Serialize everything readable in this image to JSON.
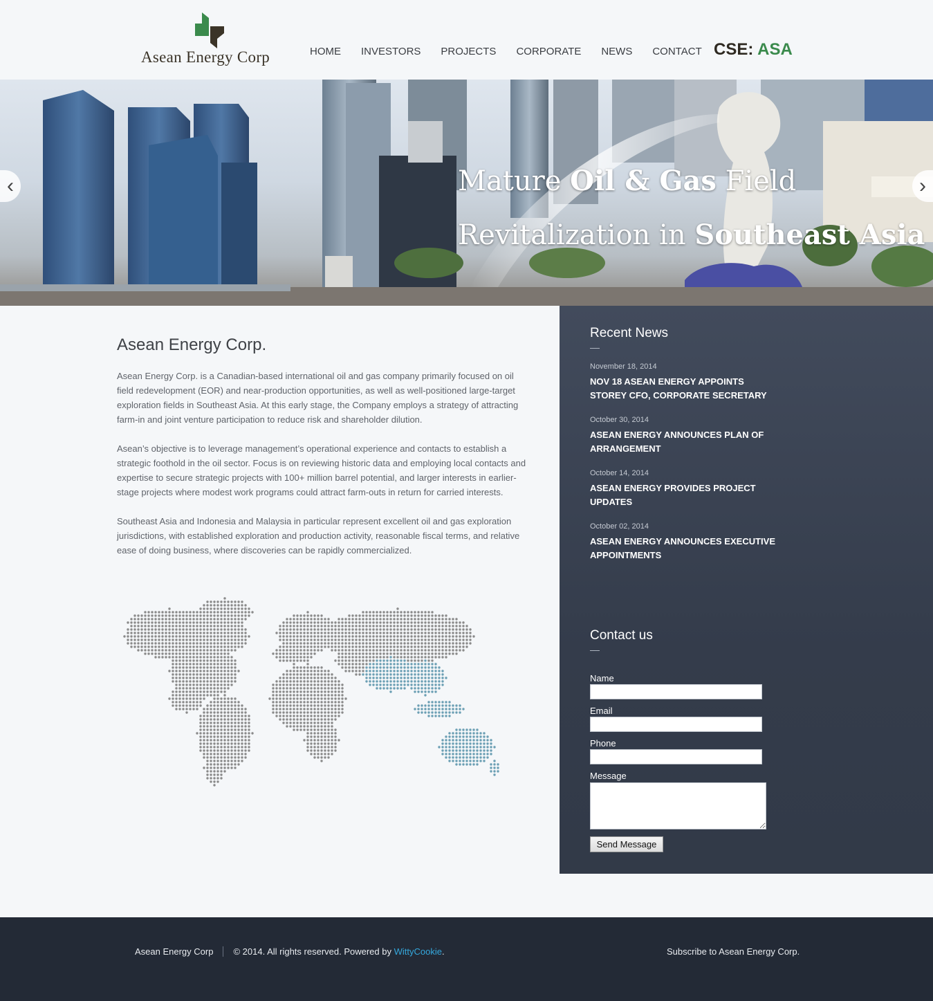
{
  "header": {
    "logo_text": "Asean Energy Corp",
    "nav": [
      "HOME",
      "INVESTORS",
      "PROJECTS",
      "CORPORATE",
      "NEWS",
      "CONTACT"
    ],
    "ticker_label": "CSE:",
    "ticker_symbol": "ASA"
  },
  "hero": {
    "line1_pre": "Mature ",
    "line1_bold": "Oil & Gas",
    "line1_post": " Field",
    "line2_pre": "Revitalization in ",
    "line2_bold": "Southeast Asia",
    "prev_icon": "‹",
    "next_icon": "›"
  },
  "main": {
    "title": "Asean Energy Corp.",
    "paragraphs": [
      "Asean Energy Corp. is a Canadian-based international oil and gas company primarily focused on oil field redevelopment (EOR) and near-production opportunities, as well as well-positioned large-target exploration fields in Southeast Asia. At this early stage, the Company employs a strategy of attracting farm-in and joint venture participation to reduce risk and shareholder dilution.",
      "Asean’s objective is to leverage management’s operational experience and contacts to establish a strategic foothold in the oil sector. Focus is on reviewing historic data and employing local contacts and expertise to secure strategic projects with 100+ million barrel potential, and larger interests in earlier-stage projects where modest work programs could attract farm-outs in return for carried interests.",
      "Southeast Asia and Indonesia and Malaysia in particular represent excellent oil and gas exploration jurisdictions, with established exploration and production activity, reasonable fiscal terms, and relative ease of doing business, where discoveries can be rapidly commercialized."
    ]
  },
  "sidebar": {
    "news_heading": "Recent News",
    "news": [
      {
        "date": "November 18, 2014",
        "title": "Nov 18 ASEAN ENERGY APPOINTS STOREY CFO, CORPORATE SECRETARY"
      },
      {
        "date": "October 30, 2014",
        "title": "ASEAN ENERGY ANNOUNCES PLAN OF ARRANGEMENT"
      },
      {
        "date": "October 14, 2014",
        "title": "ASEAN ENERGY PROVIDES PROJECT UPDATES"
      },
      {
        "date": "October 02, 2014",
        "title": "ASEAN ENERGY ANNOUNCES EXECUTIVE APPOINTMENTS"
      }
    ],
    "contact_heading": "Contact us",
    "form": {
      "name_label": "Name",
      "email_label": "Email",
      "phone_label": "Phone",
      "message_label": "Message",
      "submit_label": "Send Message"
    }
  },
  "footer": {
    "company": "Asean Energy Corp",
    "copyright_prefix": "© 2014. All rights reserved. Powered by ",
    "powered_by": "WittyCookie",
    "copyright_suffix": ".",
    "subscribe": "Subscribe to Asean Energy Corp."
  },
  "colors": {
    "accent_green": "#3a8a4c",
    "sidebar_bg": "#3a4252",
    "footer_bg": "#232a36",
    "link_blue": "#35a8dd",
    "map_dot": "#8a8a8a",
    "map_highlight": "#6b9fb4"
  }
}
